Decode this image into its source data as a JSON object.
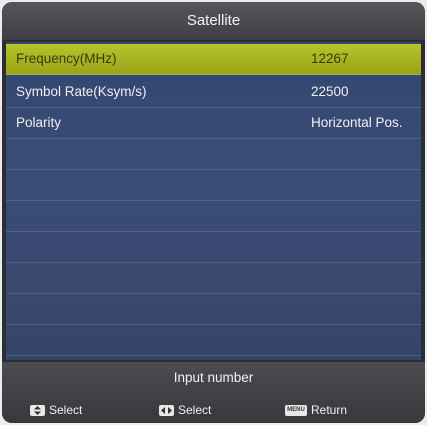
{
  "title": "Satellite",
  "rows": [
    {
      "label": "Frequency(MHz)",
      "value": "12267",
      "selected": true
    },
    {
      "label": "Symbol Rate(Ksym/s)",
      "value": "22500",
      "selected": false
    },
    {
      "label": "Polarity",
      "value": "Horizontal Pos.",
      "selected": false
    }
  ],
  "footer": {
    "hint": "Input number",
    "keys": [
      {
        "icon": "up-down-arrow-icon",
        "label": "Select"
      },
      {
        "icon": "left-right-arrow-icon",
        "label": "Select"
      },
      {
        "icon": "menu-key-icon",
        "label": "Return",
        "key_text": "MENU"
      }
    ]
  },
  "colors": {
    "highlight": "#a8b420",
    "panel": "#3a4a72",
    "title_bar": "#4a4c50"
  }
}
